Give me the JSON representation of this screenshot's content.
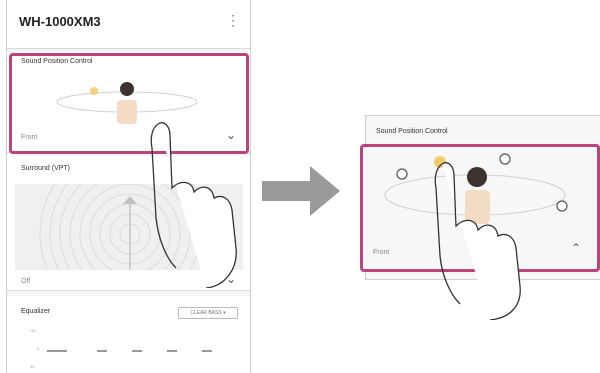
{
  "app": {
    "title": "WH-1000XM3",
    "menu_icon": "kebab-menu-icon"
  },
  "sound_position": {
    "title": "Sound Position Control",
    "value": "Front"
  },
  "surround": {
    "title": "Surround (VPT)",
    "value": "Off"
  },
  "equalizer": {
    "title": "Equalizer",
    "preset": "CLEAR BASS",
    "levels": [
      "+10",
      "0",
      "-10"
    ]
  },
  "expanded_panel": {
    "title": "Sound Position Control",
    "value": "Front"
  },
  "colors": {
    "highlight": "#b9447a",
    "arrow": "#9a9a9a",
    "selected_dot": "#f2c14e"
  }
}
